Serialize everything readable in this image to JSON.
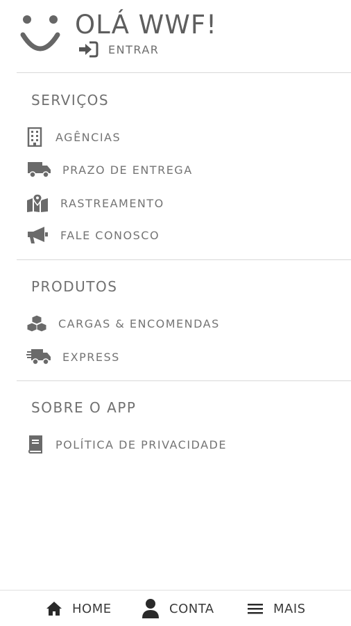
{
  "header": {
    "greeting": "OLÁ WWF!",
    "login_label": "ENTRAR",
    "avatar_icon": "smiley-icon",
    "login_icon": "sign-in-icon"
  },
  "sections": [
    {
      "title": "SERVIÇOS",
      "items": [
        {
          "label": "AGÊNCIAS",
          "icon": "building-icon"
        },
        {
          "label": "PRAZO DE ENTREGA",
          "icon": "truck-icon"
        },
        {
          "label": "RASTREAMENTO",
          "icon": "map-marker-icon"
        },
        {
          "label": "FALE CONOSCO",
          "icon": "megaphone-icon"
        }
      ]
    },
    {
      "title": "PRODUTOS",
      "items": [
        {
          "label": "CARGAS & ENCOMENDAS",
          "icon": "cubes-icon"
        },
        {
          "label": "EXPRESS",
          "icon": "fast-truck-icon"
        }
      ]
    },
    {
      "title": "SOBRE O APP",
      "items": [
        {
          "label": "POLÍTICA DE PRIVACIDADE",
          "icon": "book-icon"
        }
      ]
    }
  ],
  "bottom_nav": {
    "home_label": "HOME",
    "account_label": "CONTA",
    "more_label": "MAIS"
  },
  "colors": {
    "icon": "#6a6a6a",
    "text": "#747474",
    "divider": "#d8d8d8",
    "nav_text": "#3a3a3a"
  }
}
